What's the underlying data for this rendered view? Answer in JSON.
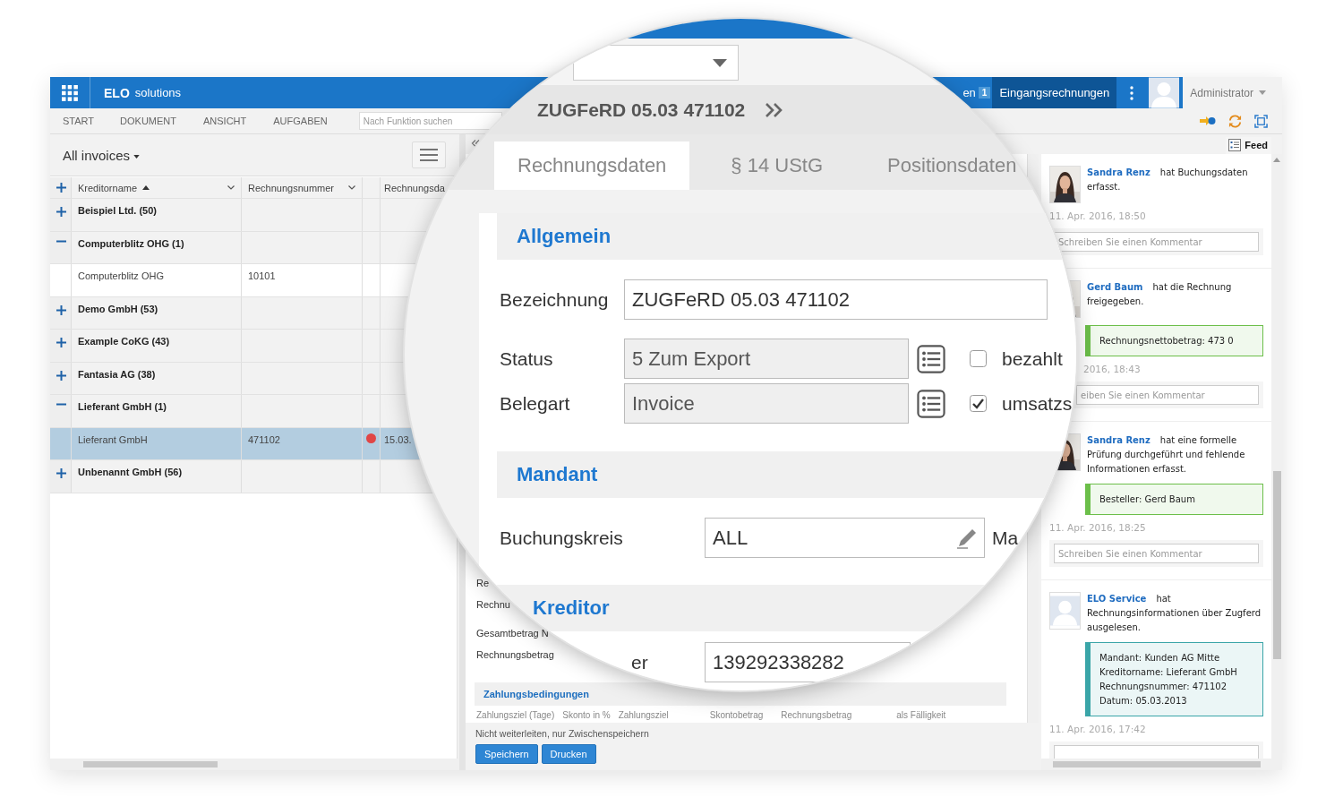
{
  "app_bar": {
    "brand": "ELO",
    "product": "solutions",
    "tabs": [
      {
        "label": "en",
        "badge": "1",
        "selected": false
      },
      {
        "label": "Eingangsrechnungen",
        "selected": true
      }
    ],
    "user": "Administrator"
  },
  "menu": {
    "items": [
      "START",
      "DOKUMENT",
      "ANSICHT",
      "AUFGABEN"
    ],
    "search": {
      "placeholder": "Nach Funktion suchen"
    }
  },
  "list_panel": {
    "view": "All invoices",
    "columns": [
      {
        "label": "Kreditorname",
        "sorted_ascending": true,
        "dropdown": true
      },
      {
        "label": "Rechnungsnummer",
        "dropdown": true
      },
      {
        "label": "Rechnungsda",
        "dropdown": false
      }
    ],
    "rows": [
      {
        "kind": "group",
        "label": "Beispiel Ltd. (50)",
        "expanded": false
      },
      {
        "kind": "group",
        "label": "Computerblitz OHG (1)",
        "expanded": true
      },
      {
        "kind": "item",
        "name": "Computerblitz OHG",
        "number": "10101",
        "selected": false
      },
      {
        "kind": "group",
        "label": "Demo GmbH (53)",
        "expanded": false
      },
      {
        "kind": "group",
        "label": "Example CoKG (43)",
        "expanded": false
      },
      {
        "kind": "group",
        "label": "Fantasia AG (38)",
        "expanded": false
      },
      {
        "kind": "group",
        "label": "Lieferant GmbH (1)",
        "expanded": true
      },
      {
        "kind": "item",
        "name": "Lieferant GmbH",
        "number": "471102",
        "color": "#e04646",
        "date": "15.03.",
        "selected": true
      },
      {
        "kind": "group",
        "label": "Unbenannt GmbH (56)",
        "expanded": false
      }
    ]
  },
  "form": {
    "fields": [
      {
        "label": "Re"
      },
      {
        "label": "Rechnu"
      },
      {
        "label": "Gesamtbetrag N"
      },
      {
        "label": "Rechnungsbetrag"
      }
    ],
    "section": "Zahlungsbedingungen",
    "columns": [
      "Zahlungsziel (Tage)",
      "Skonto in %",
      "Zahlungsziel",
      "Skontobetrag",
      "Rechnungsbetrag",
      "als Fälligkeit"
    ],
    "note": "Nicht weiterleiten, nur Zwischenspeichern",
    "buttons": [
      "Speichern",
      "Drucken"
    ]
  },
  "feed": {
    "tab": "Feed",
    "entries": [
      {
        "author": "Sandra Renz",
        "action": "hat Buchungsdaten erfasst.",
        "time": "11. Apr. 2016, 18:50",
        "comment_placeholder": "Schreiben Sie einen Kommentar"
      },
      {
        "author": "Gerd Baum",
        "action": "hat die Rechnung freigegeben.",
        "note": {
          "color": "#6cbf4a",
          "lines": [
            "Rechnungsnettobetrag: 473 0"
          ]
        },
        "time": "2016, 18:43",
        "comment_placeholder": "eiben Sie einen Kommentar"
      },
      {
        "author": "Sandra Renz",
        "action": "hat eine formelle Prüfung durchgeführt und fehlende Informationen erfasst.",
        "note": {
          "color": "#6cbf4a",
          "lines": [
            "Besteller: Gerd Baum"
          ]
        },
        "time": "11. Apr. 2016, 18:25",
        "comment_placeholder": "Schreiben Sie einen Kommentar"
      },
      {
        "avatar": {
          "kind": "silhouette"
        },
        "author": "ELO Service",
        "action": "hat Rechnungsinformationen über Zugferd ausgelesen.",
        "note": {
          "color": "#3aa5a8",
          "lines": [
            "Mandant: Kunden AG Mitte",
            "Kreditorname: Lieferant GmbH",
            "Rechnungsnummer: 471102",
            "Datum: 05.03.2013"
          ]
        },
        "time": "11. Apr. 2016, 17:42"
      }
    ]
  },
  "magnifier": {
    "document_title": "ZUGFeRD 05.03 471102",
    "tabs": [
      {
        "label": "Rechnungsdaten",
        "selected": true
      },
      {
        "label": "§ 14 UStG",
        "selected": false
      },
      {
        "label": "Positionsdaten",
        "selected": false
      }
    ],
    "sections": [
      {
        "title": "Allgemein",
        "fields": [
          {
            "kind": "text",
            "label": "Bezeichnung",
            "value": "ZUGFeRD 05.03 471102"
          },
          {
            "kind": "select",
            "label": "Status",
            "value": "5 Zum Export",
            "checkbox": {
              "label": "bezahlt",
              "checked": false
            }
          },
          {
            "kind": "select",
            "label": "Belegart",
            "value": "Invoice",
            "checkbox": {
              "label": "umsatzs",
              "checked": true
            }
          }
        ]
      },
      {
        "title": "Mandant",
        "fields": [
          {
            "kind": "edit",
            "label": "Buchungskreis",
            "value": "ALL",
            "extra_label": "Ma"
          }
        ]
      },
      {
        "title": "Kreditor",
        "fields": [
          {
            "kind": "text",
            "label": "er",
            "value": "139292338282"
          }
        ]
      }
    ]
  }
}
